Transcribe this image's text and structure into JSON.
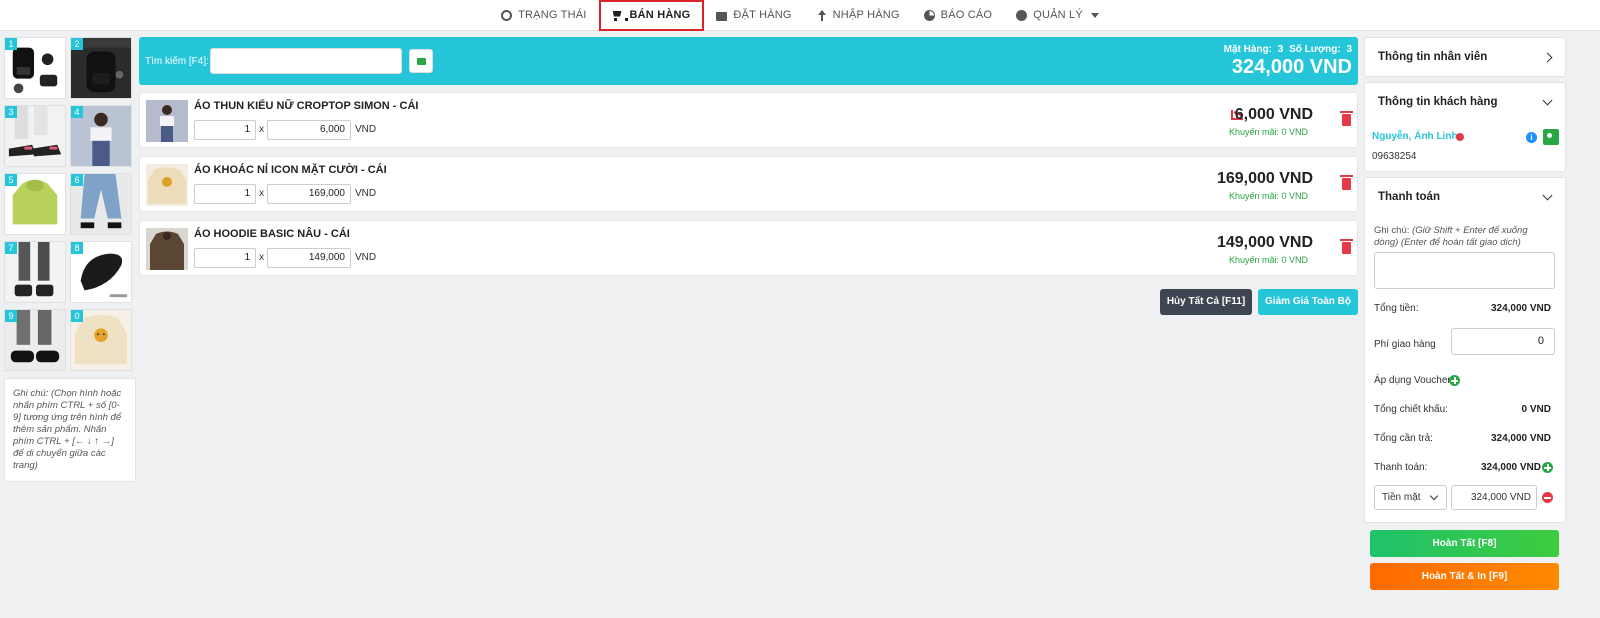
{
  "nav": {
    "items": [
      {
        "label": "TRẠNG THÁI",
        "icon": "gauge-icon"
      },
      {
        "label": "BÁN HÀNG",
        "icon": "cart-icon",
        "active": true
      },
      {
        "label": "ĐẶT HÀNG",
        "icon": "calendar-icon"
      },
      {
        "label": "NHẬP HÀNG",
        "icon": "arrow-up-icon"
      },
      {
        "label": "BÁO CÁO",
        "icon": "pie-chart-icon"
      },
      {
        "label": "QUẢN LÝ",
        "icon": "gear-icon"
      }
    ]
  },
  "product_grid": {
    "tiles": [
      "1",
      "2",
      "3",
      "4",
      "5",
      "6",
      "7",
      "8",
      "9",
      "0"
    ],
    "note": "Ghi chú: (Chọn hình hoặc nhấn phím CTRL + số [0-9] tương ứng trên hình để thêm sản phẩm. Nhấn phím CTRL + [← ↓ ↑ →] để di chuyển giữa các trang)"
  },
  "search": {
    "label": "Tìm kiếm [F4]:",
    "placeholder": ""
  },
  "summary": {
    "items_label": "Mặt Hàng:",
    "items_count": "3",
    "qty_label": "Số Lượng:",
    "qty_count": "3",
    "total": "324,000 VND"
  },
  "cart": {
    "items": [
      {
        "name": "ÁO THUN KIỂU NỮ CROPTOP SIMON - Cái",
        "qty": "1",
        "price": "6,000",
        "unit": "VND",
        "total": "6,000 VND",
        "promo": "Khuyến mãi: 0 VND"
      },
      {
        "name": "ÁO KHOÁC NỈ ICON MẶT CƯỜI - Cái",
        "qty": "1",
        "price": "169,000",
        "unit": "VND",
        "total": "169,000 VND",
        "promo": "Khuyến mãi: 0 VND"
      },
      {
        "name": "ÁO HOODIE BASIC NÂU - Cái",
        "qty": "1",
        "price": "149,000",
        "unit": "VND",
        "total": "149,000 VND",
        "promo": "Khuyến mãi: 0 VND"
      }
    ],
    "times": "x",
    "cancel_all": "Hủy Tất Cả [F11]",
    "discount_all": "Giảm Giá Toàn Bộ"
  },
  "employee": {
    "title": "Thông tin nhân viên"
  },
  "customer": {
    "title": "Thông tin khách hàng",
    "name": "Nguyễn, Ánh Linh",
    "phone": "09638254"
  },
  "payment": {
    "title": "Thanh toán",
    "note_label": "Ghi chú:",
    "note_hint": "(Giữ Shift + Enter để xuống dòng) (Enter để hoàn tất giao dịch)",
    "total_label": "Tổng tiền:",
    "total_value": "324,000 VND",
    "shipping_label": "Phí giao hàng",
    "shipping_value": "0",
    "voucher_label": "Áp dụng Voucher",
    "discount_label": "Tổng chiết khấu:",
    "discount_value": "0 VND",
    "due_label": "Tổng cần trả:",
    "due_value": "324,000 VND",
    "pay_label": "Thanh toán:",
    "pay_value": "324,000 VND",
    "method": "Tiền mặt",
    "cash_value": "324,000",
    "cash_unit": "VND",
    "done": "Hoàn Tất [F8]",
    "done_print": "Hoàn Tất & In [F9]"
  }
}
